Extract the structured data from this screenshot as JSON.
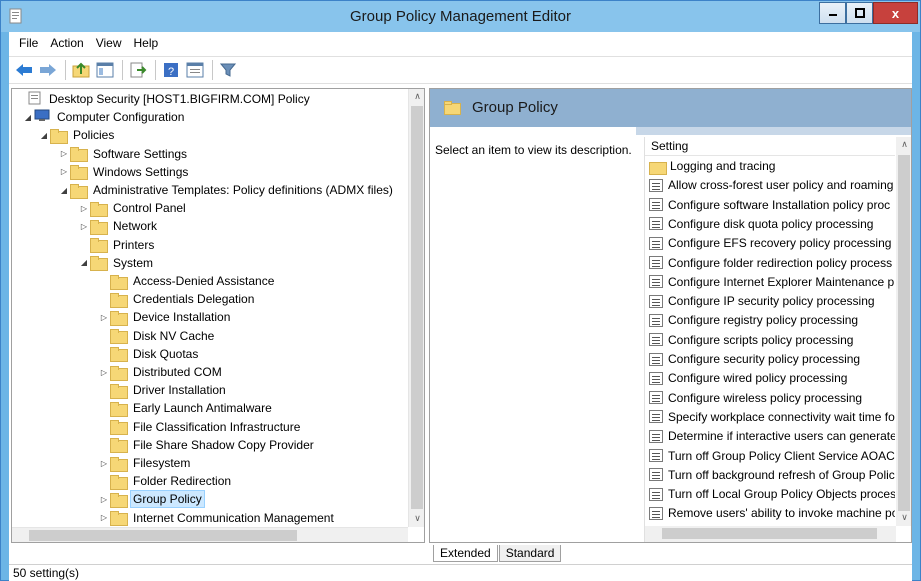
{
  "window": {
    "title": "Group Policy Management Editor",
    "close_glyph": "x",
    "accent_color": "#88c4ec"
  },
  "menu": [
    "File",
    "Action",
    "View",
    "Help"
  ],
  "toolbar": {
    "icons": [
      "back-icon",
      "forward-icon",
      "up-folder-icon",
      "show-hide-tree-icon",
      "export-list-icon",
      "help-icon",
      "properties-icon",
      "filter-icon"
    ]
  },
  "tree": {
    "items": [
      {
        "label": "Desktop Security [HOST1.BIGFIRM.COM] Policy",
        "indent": 0,
        "arrow": "",
        "icon": "policy-icon"
      },
      {
        "label": "Computer Configuration",
        "indent": 1,
        "arrow": "◢",
        "icon": "computer-icon"
      },
      {
        "label": "Policies",
        "indent": 2,
        "arrow": "◢",
        "icon": "folder-icon"
      },
      {
        "label": "Software Settings",
        "indent": 3,
        "arrow": "▷",
        "icon": "folder-icon"
      },
      {
        "label": "Windows Settings",
        "indent": 3,
        "arrow": "▷",
        "icon": "folder-icon"
      },
      {
        "label": "Administrative Templates: Policy definitions (ADMX files)",
        "indent": 3,
        "arrow": "◢",
        "icon": "folder-icon"
      },
      {
        "label": "Control Panel",
        "indent": 4,
        "arrow": "▷",
        "icon": "folder-icon"
      },
      {
        "label": "Network",
        "indent": 4,
        "arrow": "▷",
        "icon": "folder-icon"
      },
      {
        "label": "Printers",
        "indent": 4,
        "arrow": "",
        "icon": "folder-icon"
      },
      {
        "label": "System",
        "indent": 4,
        "arrow": "◢",
        "icon": "folder-icon"
      },
      {
        "label": "Access-Denied Assistance",
        "indent": 5,
        "arrow": "",
        "icon": "folder-icon"
      },
      {
        "label": "Credentials Delegation",
        "indent": 5,
        "arrow": "",
        "icon": "folder-icon"
      },
      {
        "label": "Device Installation",
        "indent": 5,
        "arrow": "▷",
        "icon": "folder-icon"
      },
      {
        "label": "Disk NV Cache",
        "indent": 5,
        "arrow": "",
        "icon": "folder-icon"
      },
      {
        "label": "Disk Quotas",
        "indent": 5,
        "arrow": "",
        "icon": "folder-icon"
      },
      {
        "label": "Distributed COM",
        "indent": 5,
        "arrow": "▷",
        "icon": "folder-icon"
      },
      {
        "label": "Driver Installation",
        "indent": 5,
        "arrow": "",
        "icon": "folder-icon"
      },
      {
        "label": "Early Launch Antimalware",
        "indent": 5,
        "arrow": "",
        "icon": "folder-icon"
      },
      {
        "label": "File Classification Infrastructure",
        "indent": 5,
        "arrow": "",
        "icon": "folder-icon"
      },
      {
        "label": "File Share Shadow Copy Provider",
        "indent": 5,
        "arrow": "",
        "icon": "folder-icon"
      },
      {
        "label": "Filesystem",
        "indent": 5,
        "arrow": "▷",
        "icon": "folder-icon"
      },
      {
        "label": "Folder Redirection",
        "indent": 5,
        "arrow": "",
        "icon": "folder-icon"
      },
      {
        "label": "Group Policy",
        "indent": 5,
        "arrow": "▷",
        "icon": "folder-icon",
        "selected": true
      },
      {
        "label": "Internet Communication Management",
        "indent": 5,
        "arrow": "▷",
        "icon": "folder-icon"
      }
    ]
  },
  "right": {
    "header_title": "Group Policy",
    "description": "Select an item to view its description.",
    "column_header": "Setting",
    "rows": [
      {
        "label": "Logging and tracing",
        "icon": "folder-icon"
      },
      {
        "label": "Allow cross-forest user policy and roaming",
        "icon": "policy-setting-icon"
      },
      {
        "label": "Configure software Installation policy proc",
        "icon": "policy-setting-icon"
      },
      {
        "label": "Configure disk quota policy processing",
        "icon": "policy-setting-icon"
      },
      {
        "label": "Configure EFS recovery policy processing",
        "icon": "policy-setting-icon"
      },
      {
        "label": "Configure folder redirection policy process",
        "icon": "policy-setting-icon"
      },
      {
        "label": "Configure Internet Explorer Maintenance p",
        "icon": "policy-setting-icon"
      },
      {
        "label": "Configure IP security policy processing",
        "icon": "policy-setting-icon"
      },
      {
        "label": "Configure registry policy processing",
        "icon": "policy-setting-icon"
      },
      {
        "label": "Configure scripts policy processing",
        "icon": "policy-setting-icon"
      },
      {
        "label": "Configure security policy processing",
        "icon": "policy-setting-icon"
      },
      {
        "label": "Configure wired policy processing",
        "icon": "policy-setting-icon"
      },
      {
        "label": "Configure wireless policy processing",
        "icon": "policy-setting-icon"
      },
      {
        "label": "Specify workplace connectivity wait time fo",
        "icon": "policy-setting-icon"
      },
      {
        "label": "Determine if interactive users can generate",
        "icon": "policy-setting-icon"
      },
      {
        "label": "Turn off Group Policy Client Service AOAC",
        "icon": "policy-setting-icon"
      },
      {
        "label": "Turn off background refresh of Group Polic",
        "icon": "policy-setting-icon"
      },
      {
        "label": "Turn off Local Group Policy Objects proces",
        "icon": "policy-setting-icon"
      },
      {
        "label": "Remove users' ability to invoke machine po",
        "icon": "policy-setting-icon"
      }
    ]
  },
  "tabs": [
    {
      "label": "Extended",
      "active": true
    },
    {
      "label": "Standard",
      "active": false
    }
  ],
  "status": "50 setting(s)"
}
